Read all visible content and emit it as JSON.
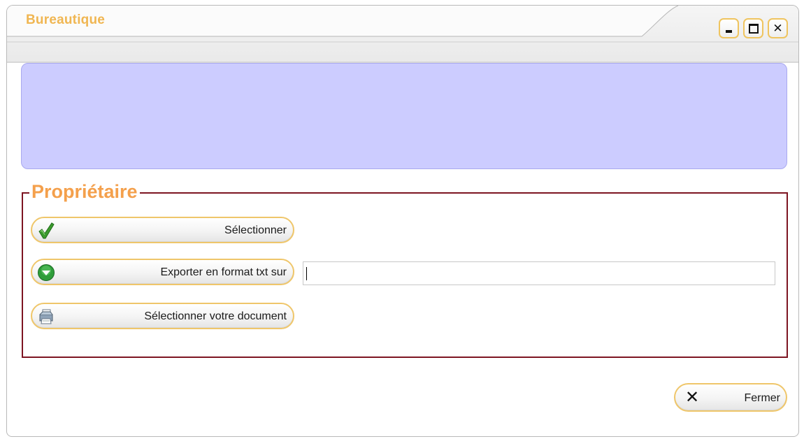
{
  "window": {
    "title": "Bureautique",
    "controls": {
      "minimize_icon": "minimize-icon",
      "maximize_icon": "maximize-icon",
      "close_icon": "close-icon",
      "close_glyph": "✕"
    }
  },
  "owner_group": {
    "legend": "Propriétaire",
    "select_button": {
      "label": "Sélectionner",
      "icon": "checkmark-icon"
    },
    "export_button": {
      "label": "Exporter en format txt sur",
      "icon": "green-down-arrow-icon"
    },
    "export_path_input": {
      "value": "",
      "placeholder": ""
    },
    "document_button": {
      "label": "Sélectionner votre document",
      "icon": "printer-icon"
    }
  },
  "footer": {
    "close_button": {
      "label": "Fermer",
      "icon": "close-x-icon",
      "glyph": "✕"
    }
  },
  "colors": {
    "title": "#f0b652",
    "legend": "#f4a04c",
    "banner_fill": "#ccccff",
    "group_border": "#7d1522",
    "button_border": "#efc66a"
  }
}
